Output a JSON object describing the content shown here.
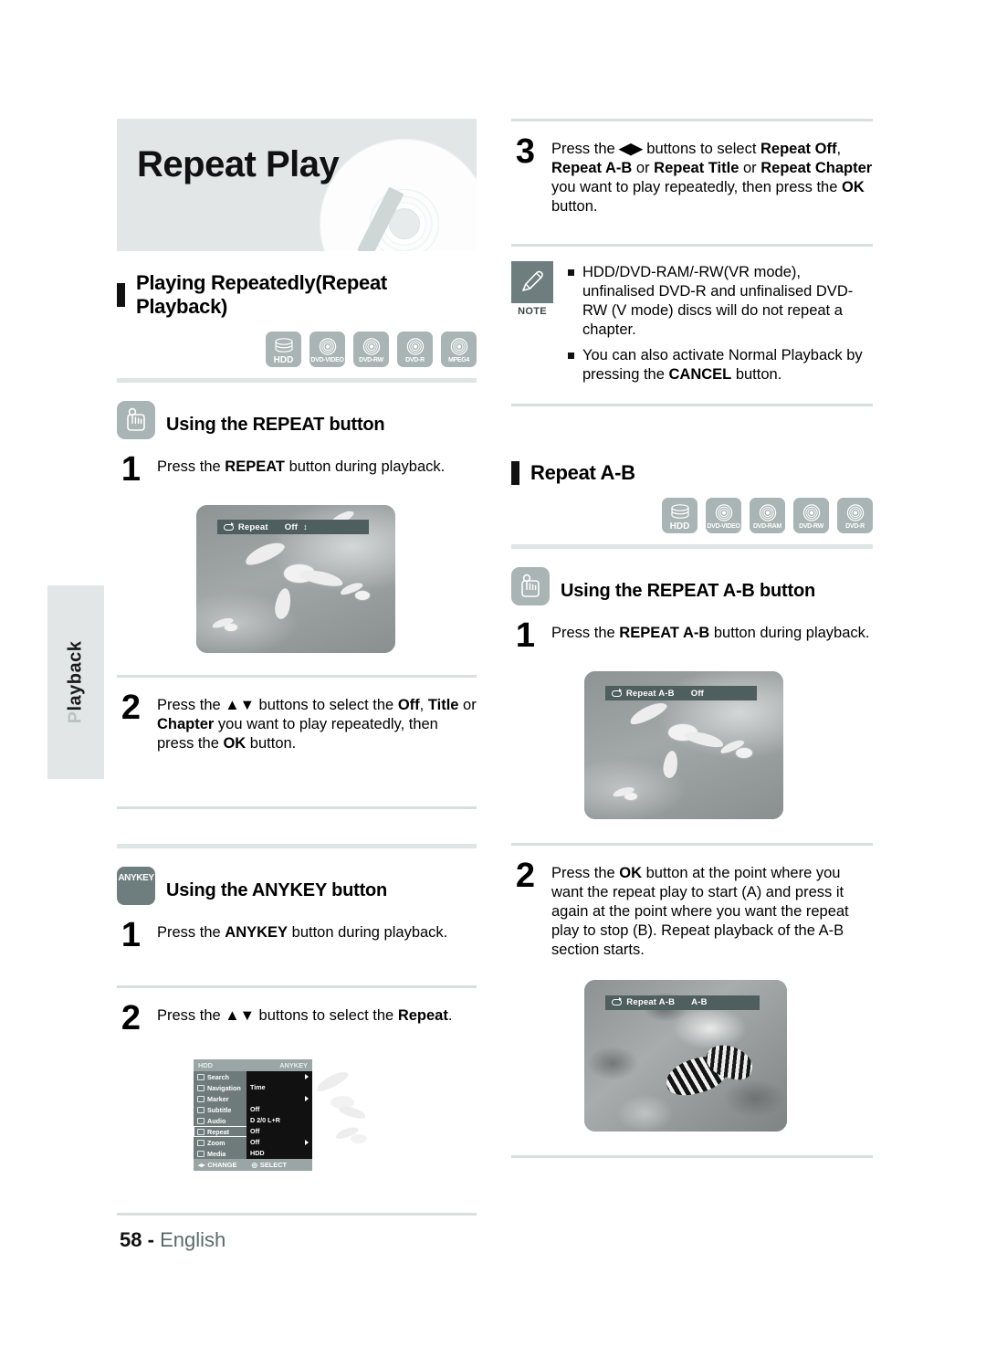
{
  "sidebar": {
    "tab_label": "Playback",
    "tab_lead_letter": "P"
  },
  "header": {
    "title": "Repeat Play",
    "disc_graphic": "dvd-disc-illustration"
  },
  "left": {
    "section": {
      "heading": "Playing Repeatedly(Repeat Playback)",
      "disc_icons": [
        {
          "label": "HDD",
          "glyph": "hdd-stack-icon"
        },
        {
          "label": "DVD-VIDEO",
          "glyph": "disc-icon"
        },
        {
          "label": "DVD-RW",
          "glyph": "disc-icon"
        },
        {
          "label": "DVD-R",
          "glyph": "disc-icon"
        },
        {
          "label": "MPEG4",
          "glyph": "disc-icon"
        }
      ]
    },
    "repeat_button": {
      "badge": "press-button-icon",
      "heading": "Using the REPEAT button",
      "steps": [
        {
          "num": "1",
          "text_html": "Press the <b>REPEAT</b> button during playback."
        },
        {
          "num": "2",
          "text_html": "Press the <b>▲▼</b> buttons to select the <b>Off</b>, <b>Title</b> or <b>Chapter</b> you want to play repeatedly, then press the <b>OK</b> button."
        }
      ],
      "osd": {
        "icon": "repeat-loop-icon",
        "label": "Repeat",
        "value": "Off",
        "spinner": "↕"
      }
    },
    "anykey": {
      "badge_label": "ANYKEY",
      "heading": "Using the ANYKEY button",
      "steps": [
        {
          "num": "1",
          "text_html": "Press the <b>ANYKEY</b> button during playback."
        },
        {
          "num": "2",
          "text_html": "Press the <b>▲▼</b> buttons to select the <b>Repeat</b>."
        }
      ],
      "menu": {
        "title_left": "HDD",
        "title_right": "ANYKEY",
        "rows": [
          {
            "icon": "search-icon",
            "label": "Search",
            "value": "",
            "arrow": true,
            "selected": false
          },
          {
            "icon": "navigation-icon",
            "label": "Navigation",
            "value": "Time",
            "arrow": false,
            "selected": false
          },
          {
            "icon": "marker-icon",
            "label": "Marker",
            "value": "",
            "arrow": true,
            "selected": false
          },
          {
            "icon": "subtitle-icon",
            "label": "Subtitle",
            "value": "Off",
            "arrow": false,
            "selected": false
          },
          {
            "icon": "audio-icon",
            "label": "Audio",
            "value": "D 2/0 L+R",
            "arrow": false,
            "selected": false
          },
          {
            "icon": "repeat-icon",
            "label": "Repeat",
            "value": "Off",
            "arrow": false,
            "selected": true
          },
          {
            "icon": "zoom-icon",
            "label": "Zoom",
            "value": "Off",
            "arrow": true,
            "selected": false
          },
          {
            "icon": "media-icon",
            "label": "Media",
            "value": "HDD",
            "arrow": false,
            "selected": false
          }
        ],
        "footer": [
          {
            "icon": "left-right-arrows-icon",
            "label": "CHANGE"
          },
          {
            "icon": "ok-button-icon",
            "label": "SELECT"
          }
        ]
      }
    }
  },
  "right": {
    "step3": {
      "num": "3",
      "text_html": "Press the <b>◀▶</b> buttons to select <b>Repeat Off</b>, <b>Repeat A-B</b> or <b>Repeat Title</b> or <b>Repeat Chapter</b> you want to play repeatedly, then press the <b>OK</b> button."
    },
    "note": {
      "icon": "pencil-note-icon",
      "caption": "NOTE",
      "items_html": [
        "HDD/DVD-RAM/-RW(VR mode), unfinalised DVD-R and unfinalised DVD-RW (V mode) discs will do not repeat a chapter.",
        "You can also activate Normal Playback by pressing the <b>CANCEL</b> button."
      ]
    },
    "section": {
      "heading": "Repeat A-B",
      "disc_icons": [
        {
          "label": "HDD",
          "glyph": "hdd-stack-icon"
        },
        {
          "label": "DVD-VIDEO",
          "glyph": "disc-icon"
        },
        {
          "label": "DVD-RAM",
          "glyph": "disc-icon"
        },
        {
          "label": "DVD-RW",
          "glyph": "disc-icon"
        },
        {
          "label": "DVD-R",
          "glyph": "disc-icon"
        }
      ]
    },
    "repeat_ab": {
      "badge": "press-button-icon",
      "heading": "Using the REPEAT A-B button",
      "steps": [
        {
          "num": "1",
          "text_html": "Press the <b>REPEAT A-B</b> button during playback."
        },
        {
          "num": "2",
          "text_html": "Press the <b>OK</b> button at the point where you want the repeat play to start (A) and press it again at the point where you want the repeat play to stop (B). Repeat playback of the A-B section starts."
        }
      ],
      "osd_first": {
        "icon": "repeat-loop-icon",
        "label": "Repeat A-B",
        "value": "Off"
      },
      "osd_second": {
        "icon": "repeat-loop-icon",
        "label": "Repeat A-B",
        "value": "A-B"
      }
    }
  },
  "footer": {
    "page_number": "58",
    "separator": "-",
    "language": "English"
  },
  "colors": {
    "banner_bg": "#e2e6e6",
    "icon_gray": "#a9b4b4",
    "dark_gray": "#6e7d7d",
    "osd_bar": "#4f5e5e",
    "rule": "#dfe4e4"
  }
}
